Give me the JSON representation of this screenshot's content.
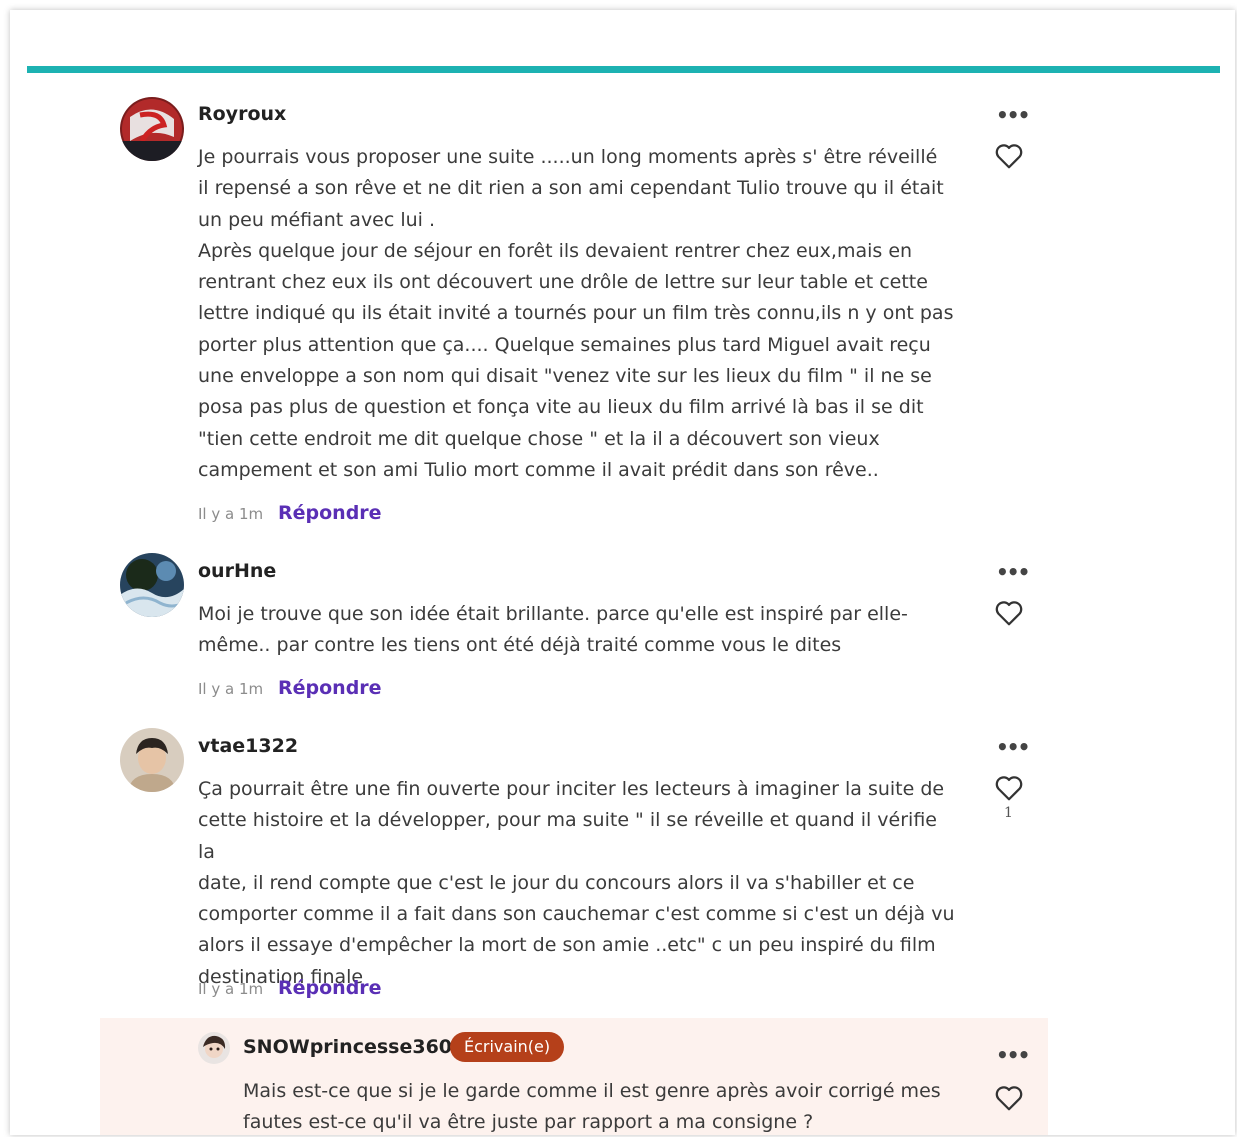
{
  "comments": [
    {
      "username": "Royroux",
      "text": "Je pourrais vous proposer une suite .....un long moments après s' être réveillé\nil repensé a son rêve et ne dit rien a son ami cependant Tulio trouve qu il était\nun peu méfiant avec lui .\nAprès quelque jour de séjour en forêt ils devaient rentrer chez eux,mais en\nrentrant chez eux ils ont découvert une drôle de lettre sur leur table et cette\nlettre indiqué qu ils était invité a tournés pour un film très connu,ils n y ont pas\nporter plus attention que ça.... Quelque semaines plus tard Miguel avait reçu\nune enveloppe a son nom qui disait \"venez vite sur les lieux du film \" il ne se\nposa pas plus de question et fonça vite au lieux du film arrivé là bas il se dit\n\"tien cette endroit me dit quelque chose \" et la il a découvert son vieux\ncampement et  son ami Tulio mort comme il avait prédit dans son rêve..",
      "time": "Il y a 1m",
      "reply_label": "Répondre",
      "likes": ""
    },
    {
      "username": "ourHne",
      "text": "Moi je trouve que son idée était brillante. parce qu'elle est  inspiré par elle-\nmême.. par contre les tiens ont été déjà traité comme vous le dites",
      "time": "Il y a 1m",
      "reply_label": "Répondre",
      "likes": ""
    },
    {
      "username": "vtae1322",
      "text": "Ça pourrait être une fin ouverte pour inciter les lecteurs à imaginer la suite de\ncette histoire et la développer, pour ma suite \" il se réveille et quand il vérifie la\ndate, il rend compte que c'est le jour du concours alors il va s'habiller et ce\ncomporter comme il a fait dans son cauchemar c'est comme si c'est un déjà vu\nalors il essaye d'empêcher la mort de son amie ..etc\" c un peu inspiré du film\ndestination finale",
      "time": "Il y a 1m",
      "reply_label": "Répondre",
      "likes": "1"
    }
  ],
  "reply": {
    "username": "SNOWprincesse360",
    "badge": "Écrivain(e)",
    "text": "Mais est-ce que si je le garde comme il est genre  après avoir corrigé mes\nfautes est-ce qu'il va être juste par rapport a ma consigne ?"
  },
  "more_glyph": "•••",
  "colors": {
    "accent_bar": "#1db2b2",
    "reply_link": "#5a2fb5",
    "badge": "#b5401a",
    "reply_bg": "#fdf2ee"
  },
  "icons": [
    "more-options-icon",
    "heart-icon"
  ]
}
